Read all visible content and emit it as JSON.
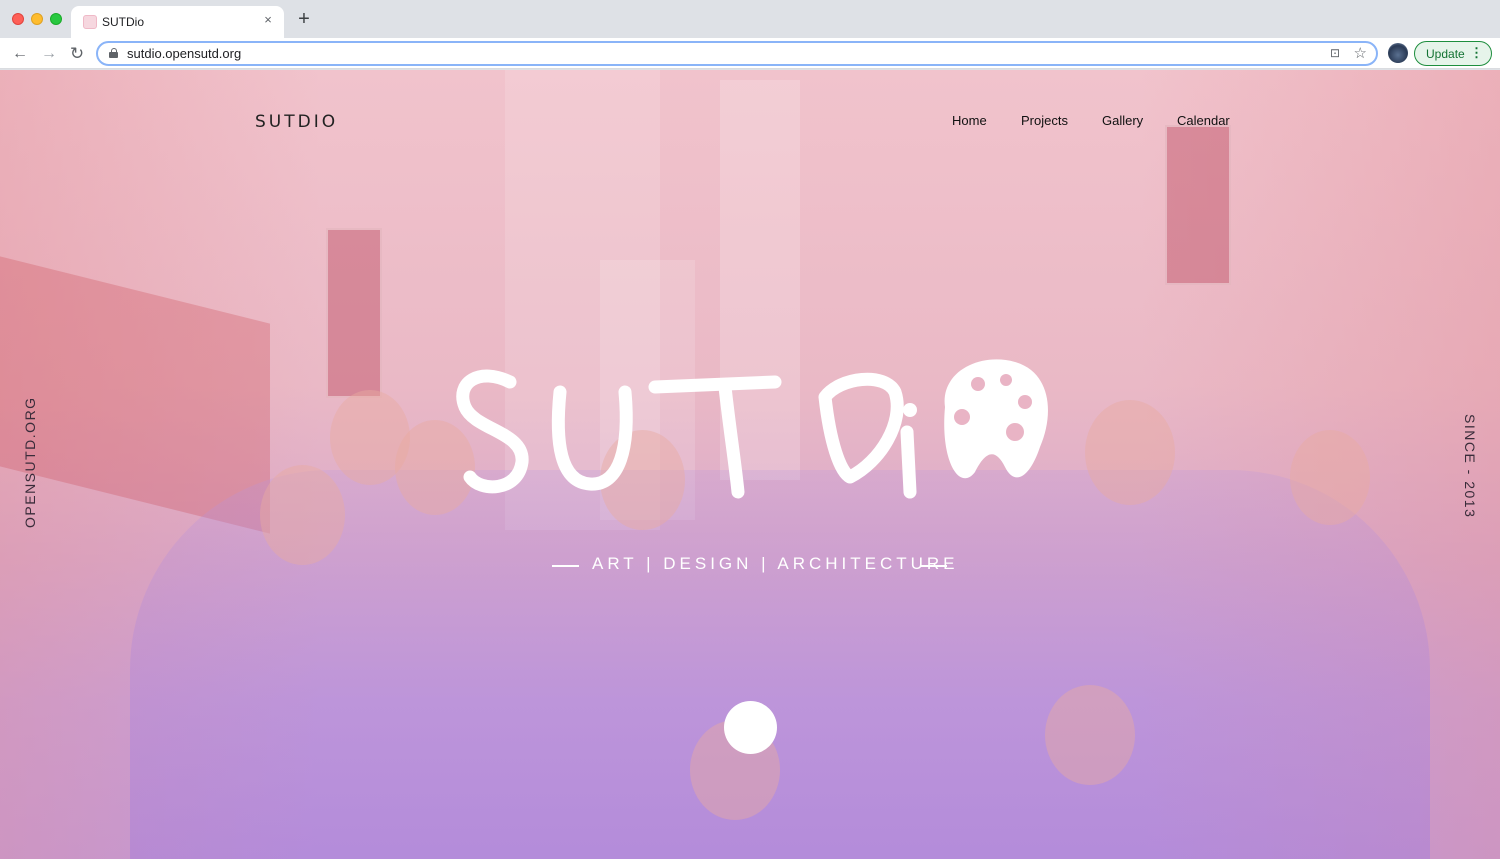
{
  "browser": {
    "tab_title": "SUTDio",
    "tab_close": "×",
    "new_tab": "+",
    "url": "sutdio.opensutd.org",
    "back": "←",
    "forward": "→",
    "reload": "↻",
    "cast_icon": "⊡",
    "star_icon": "☆",
    "update_label": "Update",
    "menu_dots": "⋮"
  },
  "site": {
    "brand": "SUTDIO",
    "nav": [
      "Home",
      "Projects",
      "Gallery",
      "Calendar"
    ],
    "side_left": "OPENSUTD.ORG",
    "side_right": "SINCE - 2013",
    "tagline": "ART | DESIGN | ARCHITECTURE",
    "accent_pink": "#f1c3cc",
    "accent_purple": "#c29ad9"
  }
}
